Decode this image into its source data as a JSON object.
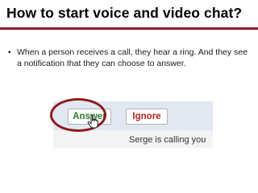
{
  "slide": {
    "title": "How to start voice and video chat?",
    "bullet_symbol": "•",
    "bullet_text": "When a person receives a call, they hear a ring. And they see a notification that they can choose to answer."
  },
  "call_notification": {
    "answer_label": "Answer",
    "ignore_label": "Ignore",
    "caller_text": "Serge is calling you"
  },
  "colors": {
    "title_rule": "#8c1c2a",
    "highlight_ring": "#8b1a1a",
    "answer_text": "#2e7d2e",
    "ignore_text": "#b22222",
    "notification_bar": "#e1e7f3"
  },
  "icons": {
    "pointer": "hand-pointer-icon"
  }
}
